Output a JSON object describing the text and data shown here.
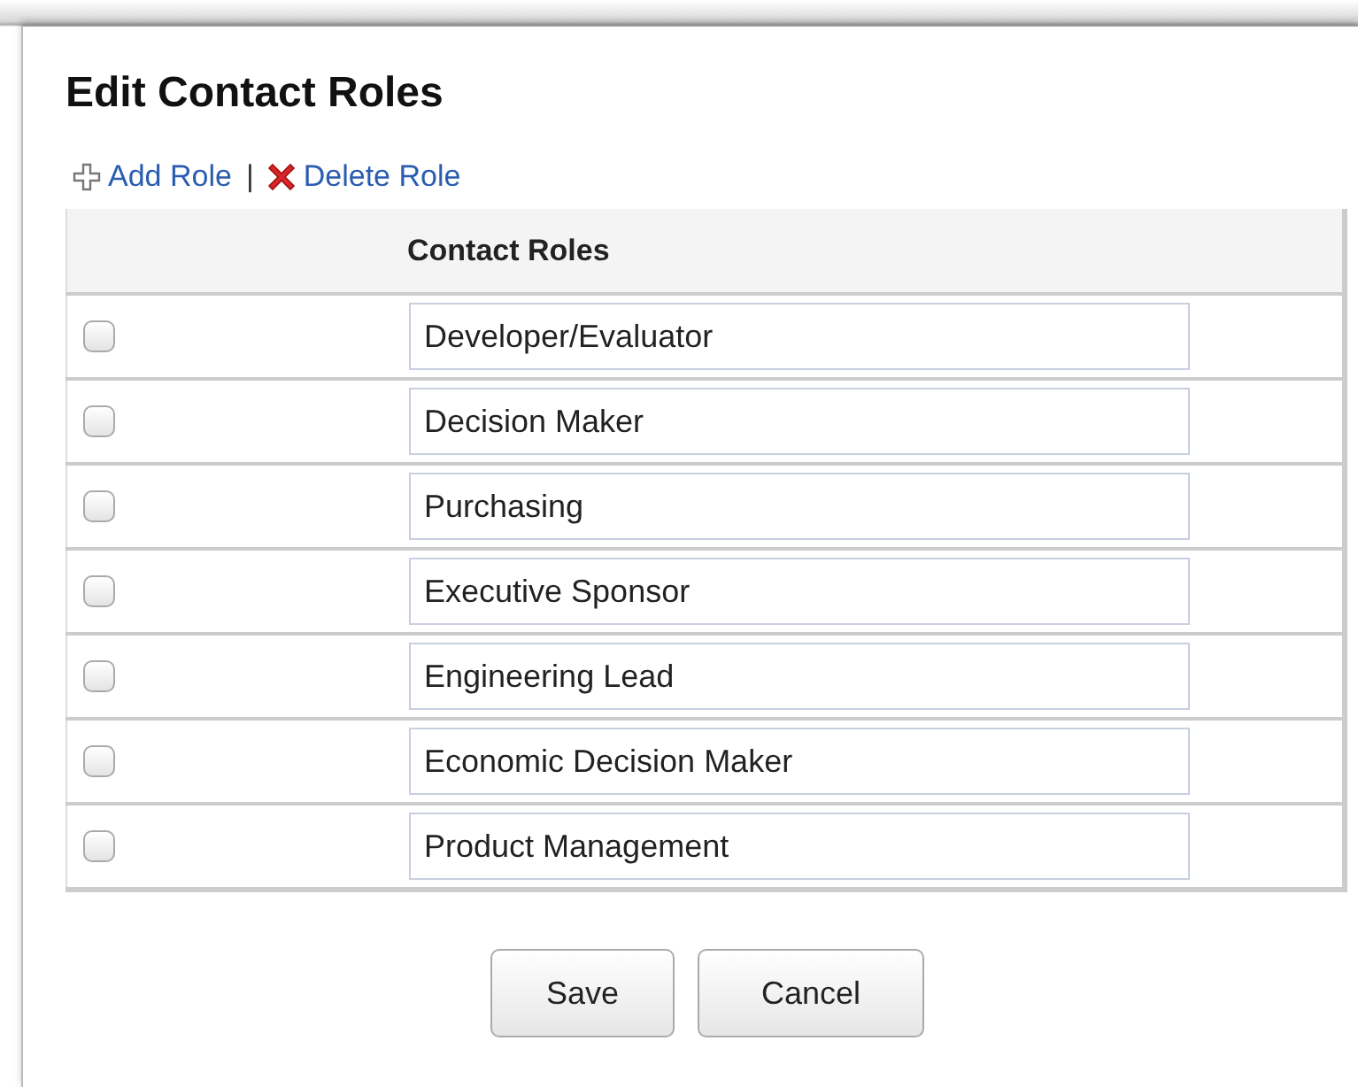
{
  "title": "Edit Contact Roles",
  "actions": [
    {
      "kind": "add",
      "label": "Add Role"
    },
    {
      "kind": "separator",
      "label": "|"
    },
    {
      "kind": "delete",
      "label": "Delete Role"
    }
  ],
  "table": {
    "column_header": "Contact Roles",
    "rows": [
      {
        "checked": false,
        "value": "Developer/Evaluator"
      },
      {
        "checked": false,
        "value": "Decision Maker"
      },
      {
        "checked": false,
        "value": "Purchasing"
      },
      {
        "checked": false,
        "value": "Executive Sponsor"
      },
      {
        "checked": false,
        "value": "Engineering Lead"
      },
      {
        "checked": false,
        "value": "Economic Decision Maker"
      },
      {
        "checked": false,
        "value": "Product Management"
      }
    ]
  },
  "buttons": [
    "Save",
    "Cancel"
  ]
}
